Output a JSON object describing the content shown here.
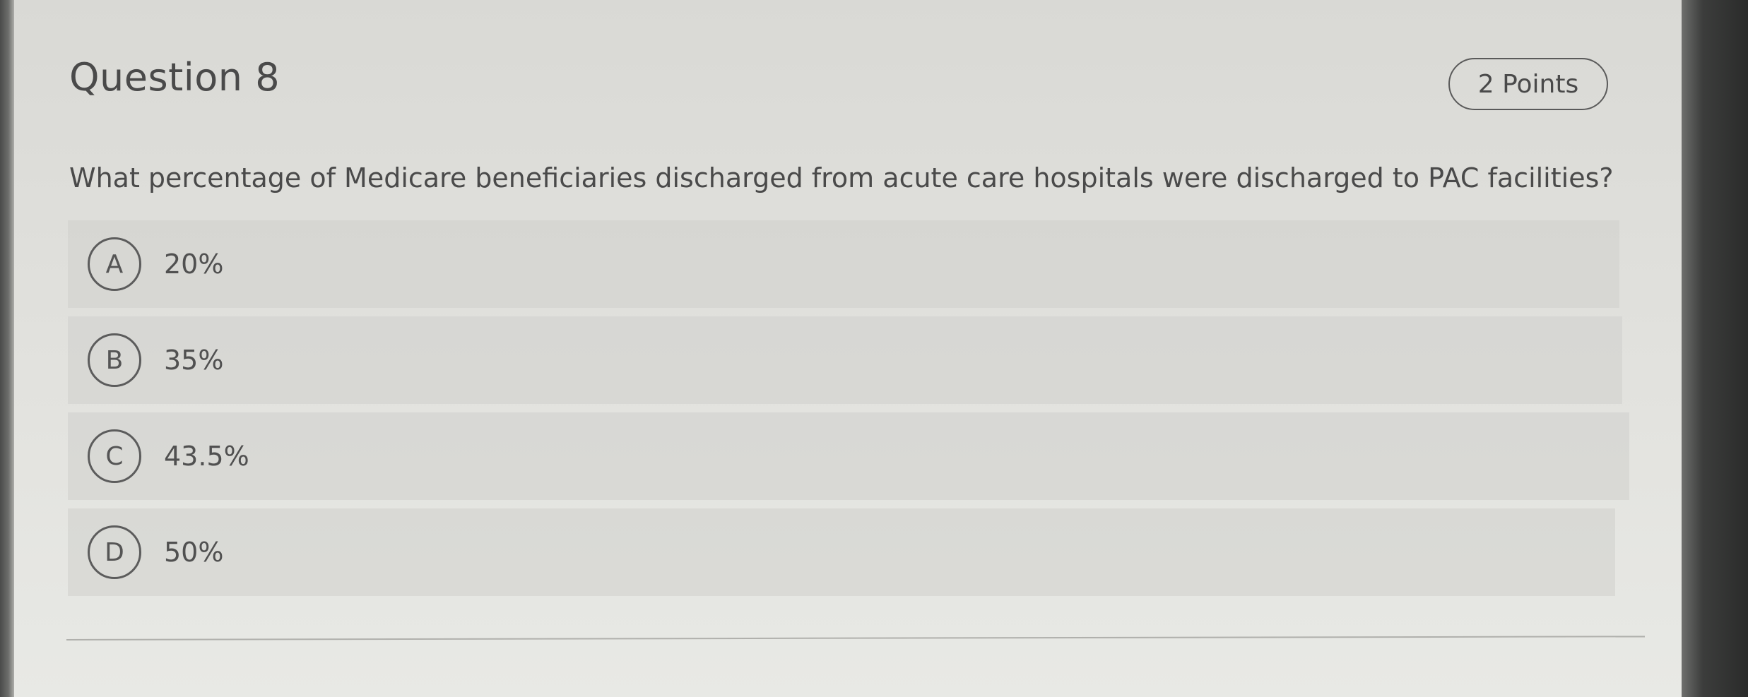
{
  "question": {
    "title": "Question 8",
    "points": "2 Points",
    "text": "What percentage of Medicare beneficiaries discharged from acute care hospitals were discharged to PAC facilities?"
  },
  "options": [
    {
      "letter": "A",
      "label": "20%"
    },
    {
      "letter": "B",
      "label": "35%"
    },
    {
      "letter": "C",
      "label": "43.5%"
    },
    {
      "letter": "D",
      "label": "50%"
    }
  ]
}
